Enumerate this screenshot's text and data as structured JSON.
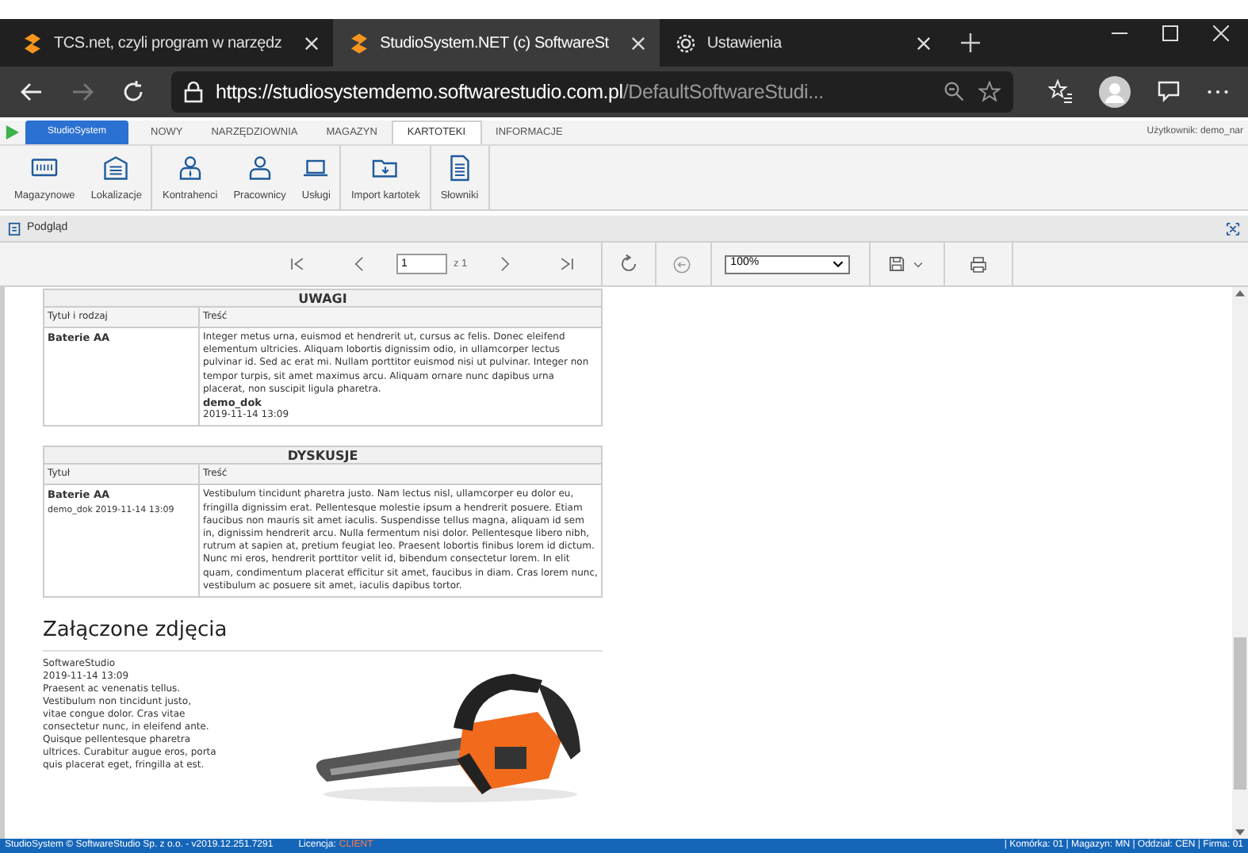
{
  "browser": {
    "tabs": [
      {
        "title": "TCS.net, czyli program w narzędz",
        "selected": false,
        "kind": "site"
      },
      {
        "title": "StudioSystem.NET (c) SoftwareSt",
        "selected": true,
        "kind": "site"
      },
      {
        "title": "Ustawienia",
        "selected": false,
        "kind": "settings"
      }
    ],
    "url_host": "https://studiosystemdemo.softwarestudio.com.pl",
    "url_path": "/DefaultSoftwareStudi..."
  },
  "app": {
    "brand": "StudioSystem",
    "menu": [
      {
        "label": "NOWY",
        "selected": false,
        "kind": "tab"
      },
      {
        "label": "NARZĘDZIOWNIA",
        "selected": false,
        "kind": "tab"
      },
      {
        "label": "MAGAZYN",
        "selected": false,
        "kind": "tab"
      },
      {
        "label": "KARTOTEKI",
        "selected": true,
        "kind": "tab"
      },
      {
        "label": "INFORMACJE",
        "selected": false,
        "kind": "tab"
      }
    ],
    "user": "Użytkownik: demo_nar",
    "ribbon_groups": [
      [
        {
          "label": "Magazynowe"
        },
        {
          "label": "Lokalizacje"
        }
      ],
      [
        {
          "label": "Kontrahenci"
        },
        {
          "label": "Pracownicy"
        },
        {
          "label": "Usługi"
        }
      ],
      [
        {
          "label": "Import kartotek"
        }
      ],
      [
        {
          "label": "Słowniki"
        }
      ]
    ]
  },
  "preview": {
    "title": "Podgląd",
    "page": "1",
    "page_count": "z 1",
    "zoom": "100%"
  },
  "report": {
    "notes": {
      "title": "UWAGI",
      "columns": [
        "Tytuł i rodzaj",
        "Treść"
      ],
      "rows": [
        {
          "title": "Baterie AA",
          "body": "Integer metus urna, euismod et hendrerit ut, cursus ac felis. Donec eleifend elementum ultricies. Aliquam lobortis dignissim odio, in ullamcorper lectus pulvinar id. Sed ac erat mi. Nullam porttitor euismod nisi ut pulvinar. Integer non tempor turpis, sit amet maximus arcu. Aliquam ornare nunc dapibus urna placerat, non suscipit ligula pharetra.",
          "author": "demo_dok",
          "date": "2019-11-14 13:09"
        }
      ]
    },
    "discussion": {
      "title": "DYSKUSJE",
      "columns": [
        "Tytuł",
        "Treść"
      ],
      "rows": [
        {
          "title": "Baterie AA",
          "meta": "demo_dok 2019-11-14 13:09",
          "body": "Vestibulum tincidunt pharetra justo. Nam lectus nisl, ullamcorper eu dolor eu, fringilla dignissim erat. Pellentesque molestie ipsum a hendrerit posuere. Etiam faucibus non mauris sit amet iaculis. Suspendisse tellus magna, aliquam id sem in, dignissim hendrerit arcu. Nulla fermentum nisi dolor. Pellentesque libero nibh, rutrum at sapien at, pretium feugiat leo. Praesent lobortis finibus lorem id dictum. Nunc mi eros, hendrerit porttitor velit id, bibendum consectetur lorem. In elit quam, condimentum placerat efficitur sit amet, faucibus in diam. Cras lorem nunc, vestibulum ac posuere sit amet, iaculis dapibus tortor."
        }
      ]
    },
    "photos": {
      "title": "Załączone zdjęcia",
      "items": [
        {
          "author": "SoftwareStudio",
          "date": "2019-11-14 13:09",
          "text": "Praesent ac venenatis tellus. Vestibulum non tincidunt justo, vitae congue dolor. Cras vitae consectetur nunc, in eleifend ante. Quisque pellentesque pharetra ultrices. Curabitur augue eros, porta quis placerat eget, fringilla at est.",
          "kind": "picture"
        }
      ]
    }
  },
  "status_bar": {
    "left": "StudioSystem © SoftwareStudio Sp. z o.o. - v2019.12.251.7291",
    "license_label": "Licencja:",
    "license": "CLIENT",
    "right": "| Komórka: 01 | Magazyn: MN | Oddział: CEN | Firma: 01"
  }
}
